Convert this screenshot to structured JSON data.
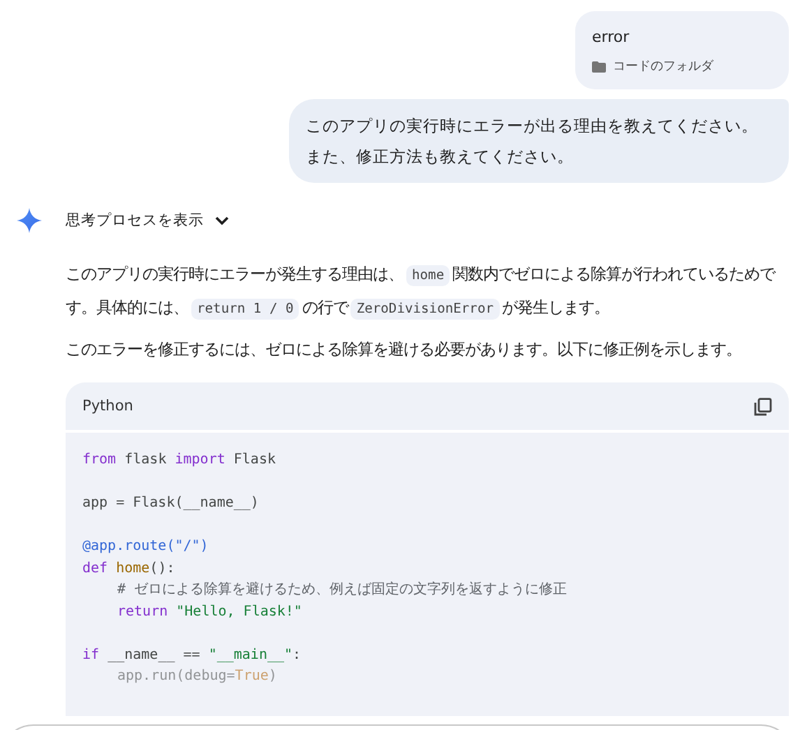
{
  "user_messages": [
    {
      "kind": "attachment",
      "title": "error",
      "file_label": "コードのフォルダ"
    },
    {
      "kind": "text",
      "text": "このアプリの実行時にエラーが出る理由を教えてください。また、修正方法も教えてください。"
    }
  ],
  "response": {
    "thoughts_toggle": {
      "label": "思考プロセスを表示",
      "expanded": false
    },
    "paragraphs": [
      [
        {
          "kind": "text",
          "text": "このアプリの実行時にエラーが発生する理由は、"
        },
        {
          "kind": "code",
          "text": "home"
        },
        {
          "kind": "text",
          "text": "関数内でゼロによる除算が行われているためです。具体的には、"
        },
        {
          "kind": "code",
          "text": "return 1 / 0"
        },
        {
          "kind": "text",
          "text": "の行で"
        },
        {
          "kind": "code",
          "text": "ZeroDivisionError"
        },
        {
          "kind": "text",
          "text": "が発生します。"
        }
      ],
      [
        {
          "kind": "text",
          "text": "このエラーを修正するには、ゼロによる除算を避ける必要があります。以下に修正例を示します。"
        }
      ]
    ],
    "code_block": {
      "language": "Python",
      "lines": [
        {
          "indented": false,
          "tokens": [
            {
              "kind": "keyword",
              "text": "from"
            },
            {
              "kind": "plain",
              "text": " flask "
            },
            {
              "kind": "keyword",
              "text": "import"
            },
            {
              "kind": "plain",
              "text": " Flask"
            }
          ]
        },
        {
          "blank": true
        },
        {
          "indented": false,
          "tokens": [
            {
              "kind": "plain",
              "text": "app = Flask(__name__)"
            }
          ]
        },
        {
          "blank": true
        },
        {
          "indented": false,
          "tokens": [
            {
              "kind": "decorator",
              "text": "@app.route(\"/\")"
            }
          ]
        },
        {
          "indented": false,
          "tokens": [
            {
              "kind": "keyword",
              "text": "def"
            },
            {
              "kind": "function",
              "text": " home"
            },
            {
              "kind": "plain",
              "text": "():"
            }
          ]
        },
        {
          "indented": true,
          "tokens": [
            {
              "kind": "comment",
              "text": "# ゼロによる除算を避けるため、例えば固定の文字列を返すように修正"
            }
          ]
        },
        {
          "indented": true,
          "tokens": [
            {
              "kind": "keyword",
              "text": "return"
            },
            {
              "kind": "string",
              "text": " \"Hello, Flask!\""
            }
          ]
        },
        {
          "blank": true
        },
        {
          "indented": false,
          "tokens": [
            {
              "kind": "keyword",
              "text": "if"
            },
            {
              "kind": "plain",
              "text": " __name__ == "
            },
            {
              "kind": "string",
              "text": "\"__main__\""
            },
            {
              "kind": "plain",
              "text": ":"
            }
          ]
        },
        {
          "indented": true,
          "tokens": [
            {
              "kind": "plain",
              "text": "app.run(debug="
            },
            {
              "kind": "constant",
              "text": "True"
            },
            {
              "kind": "plain",
              "text": ")"
            }
          ]
        }
      ]
    }
  }
}
